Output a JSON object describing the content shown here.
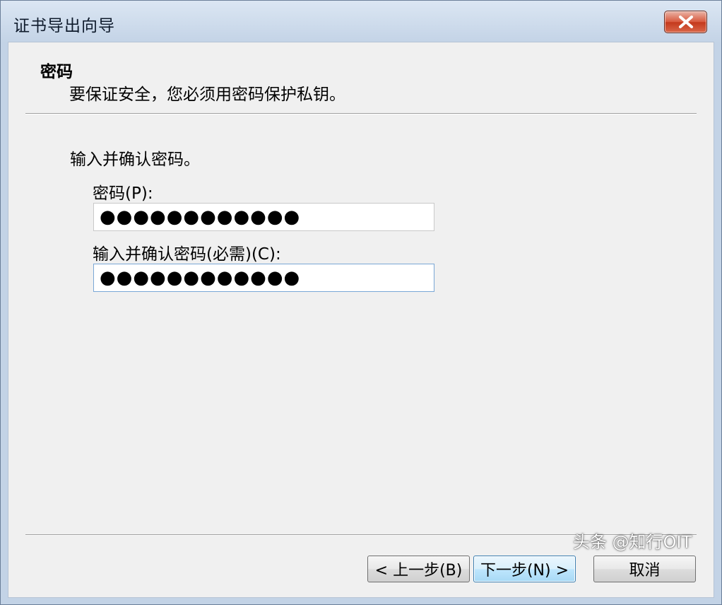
{
  "window": {
    "title": "证书导出向导"
  },
  "header": {
    "title": "密码",
    "description": "要保证安全，您必须用密码保护私钥。"
  },
  "form": {
    "instruction": "输入并确认密码。",
    "password_label": "密码(P):",
    "password_value": "●●●●●●●●●●●●",
    "confirm_label": "输入并确认密码(必需)(C):",
    "confirm_value": "●●●●●●●●●●●●"
  },
  "buttons": {
    "back": "< 上一步(B)",
    "next": "下一步(N) >",
    "cancel": "取消"
  },
  "watermark": "头条 @知行OIT",
  "colors": {
    "close_button": "#d8593d",
    "dialog_background": "#f0f0f0",
    "focused_button_border": "#3c7fb1"
  },
  "icons": {
    "close": "close-x-icon"
  }
}
